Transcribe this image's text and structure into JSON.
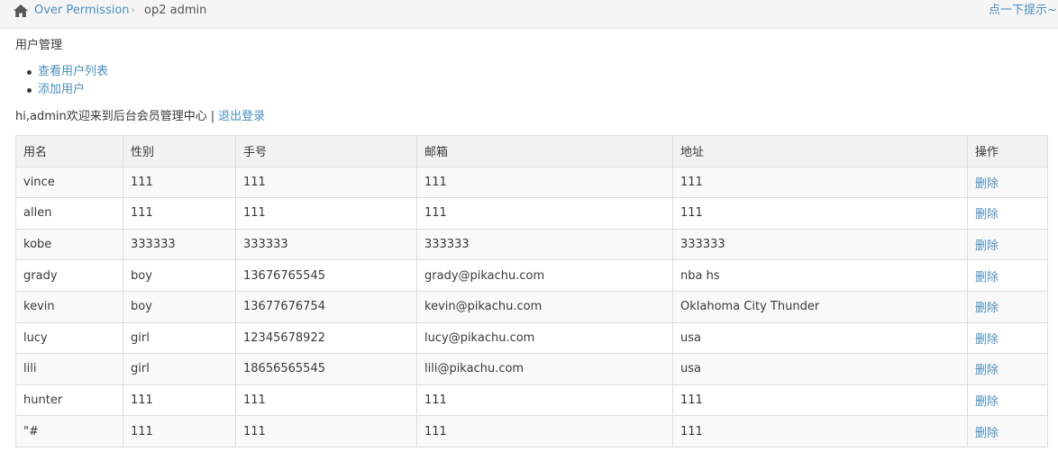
{
  "breadcrumb": {
    "home_icon": "home-icon",
    "parent": "Over Permission",
    "separator": "›",
    "current": "op2 admin"
  },
  "hint": "点一下提示~",
  "sidebar": {
    "title": "用户管理",
    "items": [
      {
        "label": "查看用户列表"
      },
      {
        "label": "添加用户"
      }
    ]
  },
  "welcome": {
    "text": "hi,admin欢迎来到后台会员管理中心",
    "separator": "|",
    "logout": "退出登录"
  },
  "table": {
    "headers": [
      "用名",
      "性别",
      "手号",
      "邮箱",
      "地址",
      "操作"
    ],
    "rows": [
      {
        "username": "vince",
        "gender": "111",
        "phone": "111",
        "email": "111",
        "address": "111",
        "action": "删除"
      },
      {
        "username": "allen",
        "gender": "111",
        "phone": "111",
        "email": "111",
        "address": "111",
        "action": "删除"
      },
      {
        "username": "kobe",
        "gender": "333333",
        "phone": "333333",
        "email": "333333",
        "address": "333333",
        "action": "删除"
      },
      {
        "username": "grady",
        "gender": "boy",
        "phone": "13676765545",
        "email": "grady@pikachu.com",
        "address": "nba hs",
        "action": "删除"
      },
      {
        "username": "kevin",
        "gender": "boy",
        "phone": "13677676754",
        "email": "kevin@pikachu.com",
        "address": "Oklahoma City Thunder",
        "action": "删除"
      },
      {
        "username": "lucy",
        "gender": "girl",
        "phone": "12345678922",
        "email": "lucy@pikachu.com",
        "address": "usa",
        "action": "删除"
      },
      {
        "username": "lili",
        "gender": "girl",
        "phone": "18656565545",
        "email": "lili@pikachu.com",
        "address": "usa",
        "action": "删除"
      },
      {
        "username": "hunter",
        "gender": "111",
        "phone": "111",
        "email": "111",
        "address": "111",
        "action": "删除"
      },
      {
        "username": "\"#",
        "gender": "111",
        "phone": "111",
        "email": "111",
        "address": "111",
        "action": "删除"
      }
    ]
  },
  "colors": {
    "link": "#4c8fbd",
    "text": "#393939",
    "border": "#dddddd",
    "topbar_bg": "#f5f5f5"
  }
}
